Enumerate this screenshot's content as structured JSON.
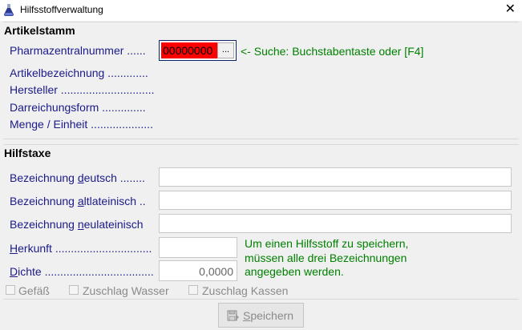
{
  "window": {
    "title": "Hilfsstoffverwaltung",
    "close_glyph": "✕",
    "icon": "flask-icon"
  },
  "artikelstamm": {
    "group_title": "Artikelstamm",
    "pzn_label": "Pharmazentralnummer ......",
    "pzn_value": "00000000",
    "pzn_button_label": "...",
    "search_hint": "<- Suche: Buchstabentaste oder [F4]",
    "artikelbezeichnung_label": "Artikelbezeichnung .............",
    "hersteller_label": "Hersteller ..............................",
    "darreichungsform_label": "Darreichungsform ..............",
    "menge_label": "Menge / Einheit ....................",
    "colors": {
      "pzn_bg": "#ff0000",
      "hint": "#008000",
      "label": "#1a1a8a"
    }
  },
  "hilfstaxe": {
    "group_title": "Hilfstaxe",
    "bez_deutsch": {
      "pre": "Bezeichnung ",
      "ul": "d",
      "post": "eutsch ........",
      "value": ""
    },
    "bez_altlat": {
      "pre": "Bezeichnung ",
      "ul": "a",
      "post": "ltlateinisch ..",
      "value": ""
    },
    "bez_neulat": {
      "pre": "Bezeichnung ",
      "ul": "n",
      "post": "eulateinisch",
      "value": ""
    },
    "herkunft": {
      "ul": "H",
      "post": "erkunft ...............................",
      "value": ""
    },
    "dichte": {
      "ul": "D",
      "post": "ichte ...................................",
      "value": "0,0000"
    },
    "save_hint_line1": "Um einen Hilfsstoff zu speichern,",
    "save_hint_line2": "müssen alle drei Bezeichnungen",
    "save_hint_line3": "angegeben werden."
  },
  "checkboxes": [
    {
      "label": "Gefäß",
      "checked": false
    },
    {
      "label": "Zuschlag Wasser",
      "checked": false
    },
    {
      "label": "Zuschlag Kassen",
      "checked": false
    }
  ],
  "save_button": {
    "ul": "S",
    "post": "peichern",
    "icon": "save-icon",
    "enabled": false
  }
}
